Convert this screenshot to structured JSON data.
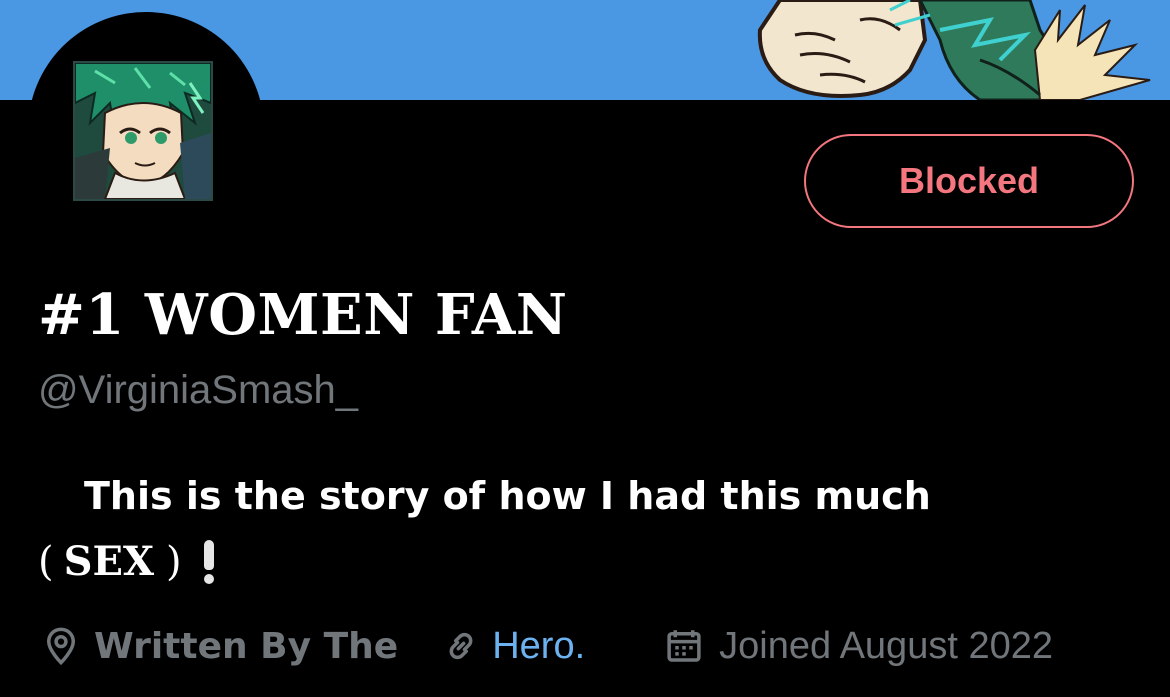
{
  "profile": {
    "display_name": "#1 WOMEN FAN",
    "handle": "@VirginiaSmash_",
    "bio_line1": "This is the story of how I had this much",
    "bio_open_paren": "(",
    "bio_word": "SEX",
    "bio_close_paren": ")",
    "location": "Written By The",
    "website": "Hero.",
    "joined": "Joined August 2022"
  },
  "actions": {
    "blocked_label": "Blocked"
  },
  "icons": {
    "location": "location-pin-icon",
    "link": "link-icon",
    "calendar": "calendar-icon",
    "exclamation": "exclamation-emoji-icon"
  },
  "colors": {
    "banner": "#4a97e3",
    "background": "#000000",
    "blocked": "#f4767e",
    "link": "#6cb2f0",
    "secondary_text": "#71767b"
  }
}
